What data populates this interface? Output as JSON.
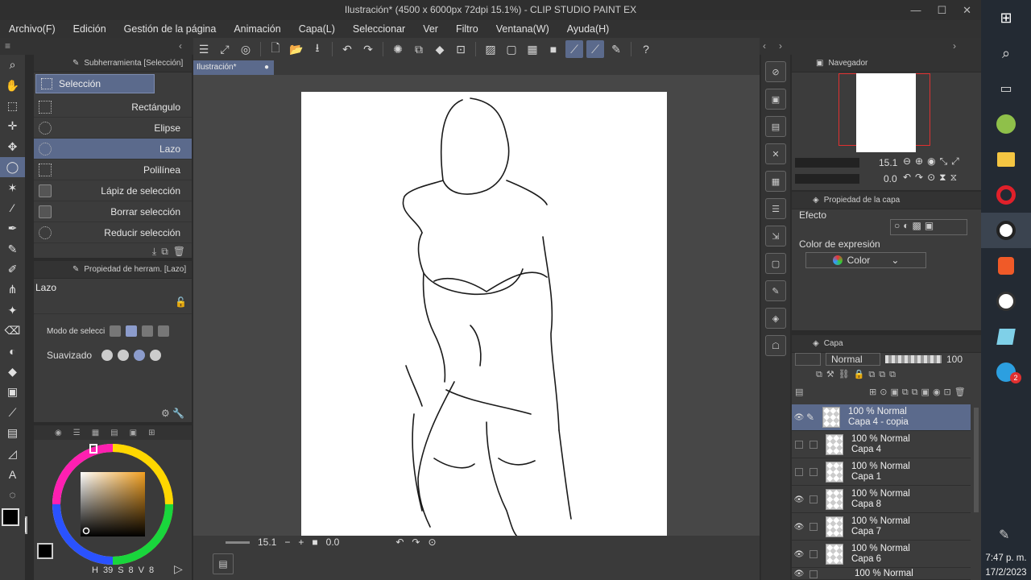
{
  "window": {
    "title": "Ilustración* (4500 x 6000px 72dpi 15.1%)  - CLIP STUDIO PAINT EX"
  },
  "menu": [
    "Archivo(F)",
    "Edición",
    "Gestión de la página",
    "Animación",
    "Capa(L)",
    "Seleccionar",
    "Ver",
    "Filtro",
    "Ventana(W)",
    "Ayuda(H)"
  ],
  "subtool": {
    "header": "Subherramienta [Selección]",
    "tab": "Selección",
    "items": [
      "Rectángulo",
      "Elipse",
      "Lazo",
      "Polilínea",
      "Lápiz de selección",
      "Borrar selección",
      "Reducir selección"
    ],
    "active": "Lazo"
  },
  "tool_property": {
    "header": "Propiedad de herram. [Lazo]",
    "name": "Lazo",
    "mode_label": "Modo de selección",
    "smoothing_label": "Suavizado"
  },
  "document": {
    "tab": "Ilustración*"
  },
  "status": {
    "zoom": "15.1",
    "angle": "0.0"
  },
  "color_readout": {
    "h": "39",
    "s": "8",
    "v": "8"
  },
  "navigator": {
    "header": "Navegador",
    "zoom": "15.1",
    "rotation": "0.0"
  },
  "layer_property": {
    "header": "Propiedad de la capa",
    "effect_label": "Efecto",
    "expression_label": "Color de expresión",
    "expression_value": "Color"
  },
  "layers": {
    "header": "Capa",
    "blend": "Normal",
    "opacity": "100",
    "rows": [
      {
        "line1": "100 % Normal",
        "line2": "Capa 4 - copia",
        "visible": true,
        "selected": true
      },
      {
        "line1": "100 % Normal",
        "line2": "Capa 4",
        "visible": false,
        "selected": false
      },
      {
        "line1": "100 % Normal",
        "line2": "Capa 1",
        "visible": false,
        "selected": false
      },
      {
        "line1": "100 % Normal",
        "line2": "Capa 8",
        "visible": true,
        "selected": false
      },
      {
        "line1": "100 % Normal",
        "line2": "Capa 7",
        "visible": true,
        "selected": false
      },
      {
        "line1": "100 % Normal",
        "line2": "Capa 6",
        "visible": true,
        "selected": false
      },
      {
        "line1": "100 % Normal",
        "line2": "",
        "visible": true,
        "selected": false
      }
    ]
  },
  "taskbar": {
    "time": "7:47 p. m.",
    "date": "17/2/2023",
    "badge": "2"
  }
}
